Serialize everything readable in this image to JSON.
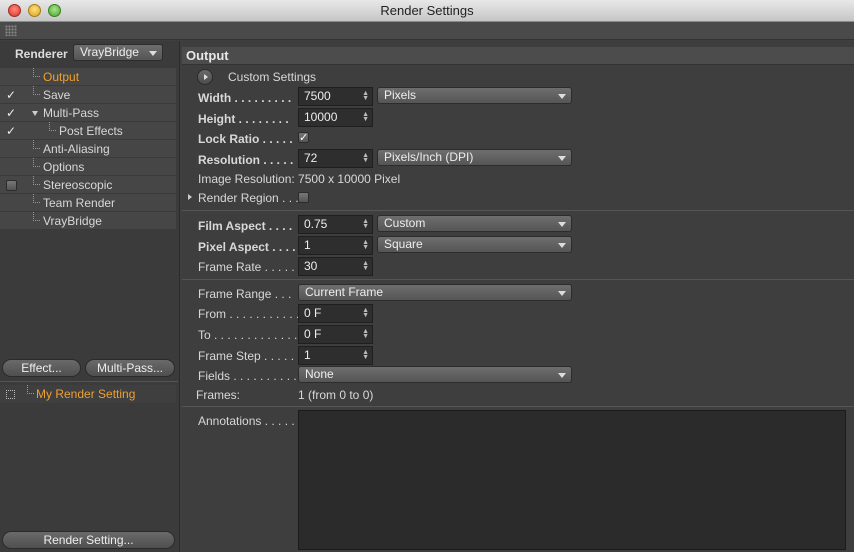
{
  "window": {
    "title": "Render Settings"
  },
  "left": {
    "renderer_label": "Renderer",
    "renderer_value": "VrayBridge",
    "tree": [
      {
        "label": "Output",
        "active": true,
        "check": ""
      },
      {
        "label": "Save",
        "check": "✓"
      },
      {
        "label": "Multi-Pass",
        "check": "✓"
      },
      {
        "label": "Post Effects",
        "check": "✓"
      },
      {
        "label": "Anti-Aliasing",
        "check": ""
      },
      {
        "label": "Options",
        "check": ""
      },
      {
        "label": "Stereoscopic",
        "check": "box"
      },
      {
        "label": "Team Render",
        "check": ""
      },
      {
        "label": "VrayBridge",
        "check": ""
      }
    ],
    "effect_button": "Effect...",
    "multipass_button": "Multi-Pass...",
    "render_setting_item": "My Render Setting",
    "render_setting_button": "Render Setting..."
  },
  "panel": {
    "header": "Output",
    "custom_settings": "Custom Settings",
    "width_label": "Width . . . . . . . . .",
    "width_value": "7500",
    "width_unit": "Pixels",
    "height_label": "Height . . . . . . . .",
    "height_value": "10000",
    "lock_ratio_label": "Lock Ratio . . . . .",
    "lock_ratio_checked": "✓",
    "resolution_label": "Resolution . . . . .",
    "resolution_value": "72",
    "resolution_unit": "Pixels/Inch (DPI)",
    "image_resolution": "Image Resolution: 7500 x 10000 Pixel",
    "render_region_label": "Render Region . . .",
    "film_aspect_label": "Film Aspect . . . .",
    "film_aspect_value": "0.75",
    "film_aspect_preset": "Custom",
    "pixel_aspect_label": "Pixel Aspect . . . .",
    "pixel_aspect_value": "1",
    "pixel_aspect_preset": "Square",
    "frame_rate_label": "Frame Rate . . . . .",
    "frame_rate_value": "30",
    "frame_range_label": "Frame Range . . .",
    "frame_range_value": "Current Frame",
    "from_label": "From . . . . . . . . . . .",
    "from_value": "0 F",
    "to_label": "To . . . . . . . . . . . . .",
    "to_value": "0 F",
    "frame_step_label": "Frame Step . . . . .",
    "frame_step_value": "1",
    "fields_label": "Fields . . . . . . . . . .",
    "fields_value": "None",
    "frames_label": "Frames:",
    "frames_value": "1 (from 0 to 0)",
    "annotations_label": "Annotations . . . . ."
  }
}
